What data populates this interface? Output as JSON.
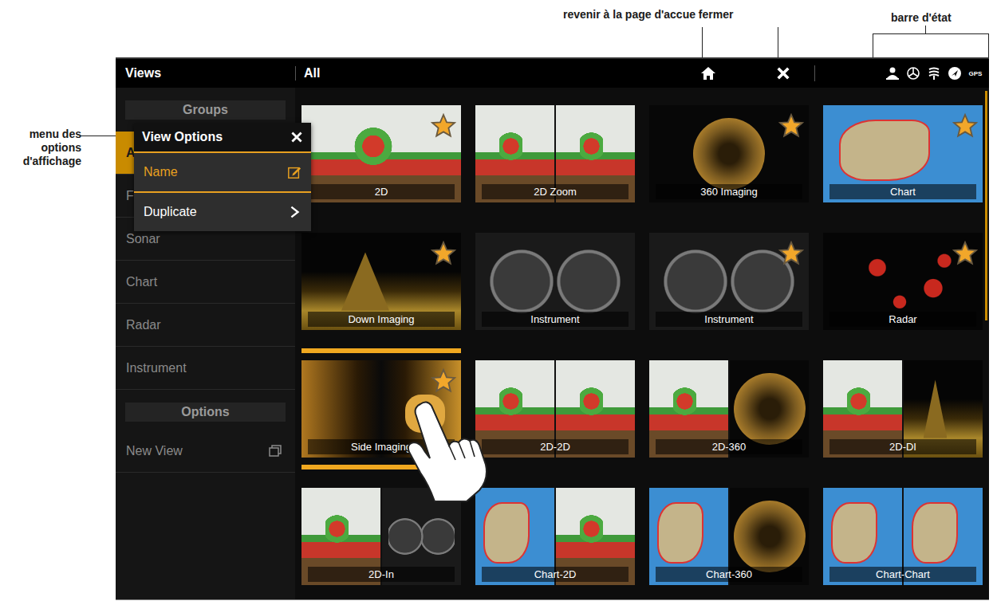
{
  "annotations": {
    "home_close": "revenir à la page d'accue fermer",
    "status_bar": "barre d'état",
    "menu": "menu des options d'affichage"
  },
  "top_bar": {
    "title": "Views",
    "group": "All"
  },
  "status_bar": {
    "gps": "GPS"
  },
  "sidebar": {
    "groups_header": "Groups",
    "items": [
      {
        "label": "A",
        "selected": true
      },
      {
        "label": "F",
        "selected": false
      },
      {
        "label": "Sonar",
        "selected": false
      },
      {
        "label": "Chart",
        "selected": false
      },
      {
        "label": "Radar",
        "selected": false
      },
      {
        "label": "Instrument",
        "selected": false
      }
    ],
    "options_header": "Options",
    "new_view": "New View"
  },
  "menu": {
    "title": "View Options",
    "items": [
      {
        "label": "Name",
        "kind": "edit",
        "selected": true
      },
      {
        "label": "Duplicate",
        "kind": "submenu",
        "selected": false
      }
    ]
  },
  "tiles": [
    {
      "label": "2D",
      "favorite": true,
      "selected": false,
      "panes": [
        "sonar"
      ]
    },
    {
      "label": "2D Zoom",
      "favorite": false,
      "selected": false,
      "panes": [
        "sonar",
        "sonar"
      ]
    },
    {
      "label": "360 Imaging",
      "favorite": true,
      "selected": false,
      "panes": [
        "circle"
      ]
    },
    {
      "label": "Chart",
      "favorite": true,
      "selected": false,
      "panes": [
        "chart"
      ]
    },
    {
      "label": "Down Imaging",
      "favorite": true,
      "selected": false,
      "panes": [
        "di"
      ]
    },
    {
      "label": "Instrument",
      "favorite": false,
      "selected": false,
      "panes": [
        "gauges"
      ]
    },
    {
      "label": "Instrument",
      "favorite": true,
      "selected": false,
      "panes": [
        "gauges"
      ]
    },
    {
      "label": "Radar",
      "favorite": true,
      "selected": false,
      "panes": [
        "radar"
      ]
    },
    {
      "label": "Side Imaging",
      "favorite": true,
      "selected": true,
      "panes": [
        "si"
      ]
    },
    {
      "label": "2D-2D",
      "favorite": false,
      "selected": false,
      "panes": [
        "sonar",
        "sonar"
      ]
    },
    {
      "label": "2D-360",
      "favorite": false,
      "selected": false,
      "panes": [
        "sonar",
        "circle"
      ]
    },
    {
      "label": "2D-DI",
      "favorite": false,
      "selected": false,
      "panes": [
        "sonar",
        "di"
      ]
    },
    {
      "label": "2D-In",
      "favorite": false,
      "selected": false,
      "panes": [
        "sonar",
        "gauges"
      ]
    },
    {
      "label": "Chart-2D",
      "favorite": false,
      "selected": false,
      "panes": [
        "chart",
        "sonar"
      ]
    },
    {
      "label": "Chart-360",
      "favorite": false,
      "selected": false,
      "panes": [
        "chart",
        "circle"
      ]
    },
    {
      "label": "Chart-Chart",
      "favorite": false,
      "selected": false,
      "panes": [
        "chart",
        "chart"
      ]
    }
  ]
}
